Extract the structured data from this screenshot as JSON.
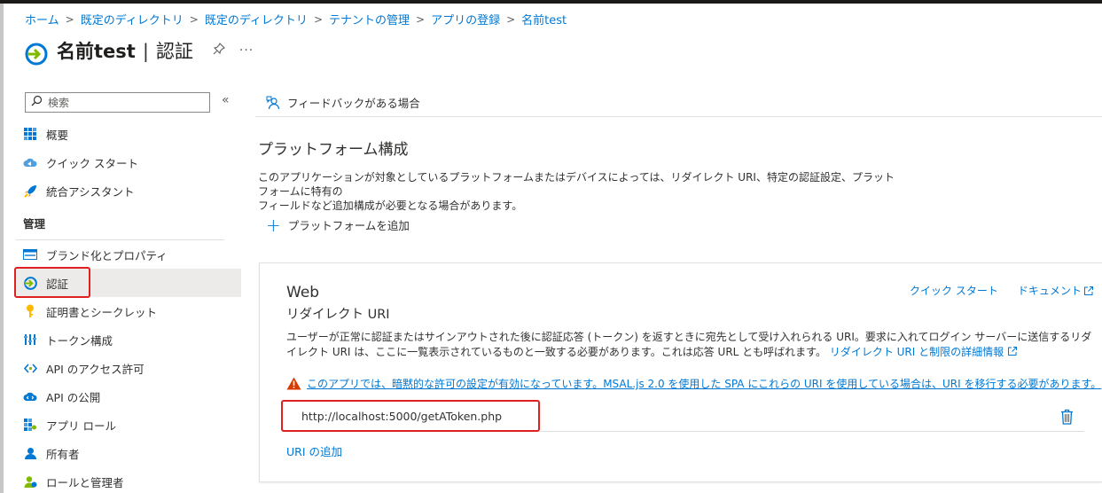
{
  "breadcrumb": [
    {
      "label": "ホーム"
    },
    {
      "label": "既定のディレクトリ"
    },
    {
      "label": "既定のディレクトリ"
    },
    {
      "label": "テナントの管理"
    },
    {
      "label": "アプリの登録"
    },
    {
      "label": "名前test"
    }
  ],
  "header": {
    "app_name": "名前test",
    "separator": "|",
    "page_name": "認証",
    "pin_icon": "pin-icon",
    "more_label": "···"
  },
  "sidebar": {
    "search_placeholder": "検索",
    "collapse_label": "«",
    "top_items": [
      {
        "label": "概要",
        "icon": "grid-icon"
      },
      {
        "label": "クイック スタート",
        "icon": "cloud-icon"
      },
      {
        "label": "統合アシスタント",
        "icon": "rocket-icon"
      }
    ],
    "section_label": "管理",
    "manage_items": [
      {
        "label": "ブランド化とプロパティ",
        "icon": "branding-icon"
      },
      {
        "label": "認証",
        "icon": "auth-arrow-icon",
        "active": true
      },
      {
        "label": "証明書とシークレット",
        "icon": "key-icon"
      },
      {
        "label": "トークン構成",
        "icon": "token-bars-icon"
      },
      {
        "label": "API のアクセス許可",
        "icon": "api-permission-icon"
      },
      {
        "label": "API の公開",
        "icon": "cloud-api-icon"
      },
      {
        "label": "アプリ ロール",
        "icon": "app-roles-icon"
      },
      {
        "label": "所有者",
        "icon": "owners-icon"
      },
      {
        "label": "ロールと管理者",
        "icon": "roles-admin-icon"
      }
    ]
  },
  "commandbar": {
    "feedback_label": "フィードバックがある場合"
  },
  "main": {
    "heading": "プラットフォーム構成",
    "description_line1": "このアプリケーションが対象としているプラットフォームまたはデバイスによっては、リダイレクト URI、特定の認証設定、プラットフォームに特有の",
    "description_line2": "フィールドなど追加構成が必要となる場合があります。",
    "add_platform_label": "プラットフォームを追加",
    "add_platform_symbol": "+"
  },
  "web_card": {
    "title": "Web",
    "subtitle": "リダイレクト URI",
    "quickstart_link": "クイック スタート",
    "docs_link": "ドキュメント",
    "description": "ユーザーが正常に認証またはサインアウトされた後に認証応答 (トークン) を返すときに宛先として受け入れられる URI。要求に入れてログイン サーバーに送信するリダイレクト URI は、ここに一覧表示されているものと一致する必要があります。これは応答 URL とも呼ばれます。",
    "description_link": "リダイレクト URI と制限の詳細情報",
    "warning_text": "このアプリでは、暗黙的な許可の設定が有効になっています。MSAL.js 2.0 を使用した SPA にこれらの URI を使用している場合は、URI を移行する必要があります。",
    "warning_arrow": "→",
    "uri_value": "http://localhost:5000/getAToken.php",
    "add_uri_label": "URI の追加"
  },
  "colors": {
    "accent": "#0078d4",
    "highlight_box": "#e02020",
    "warning": "#d83b01"
  }
}
